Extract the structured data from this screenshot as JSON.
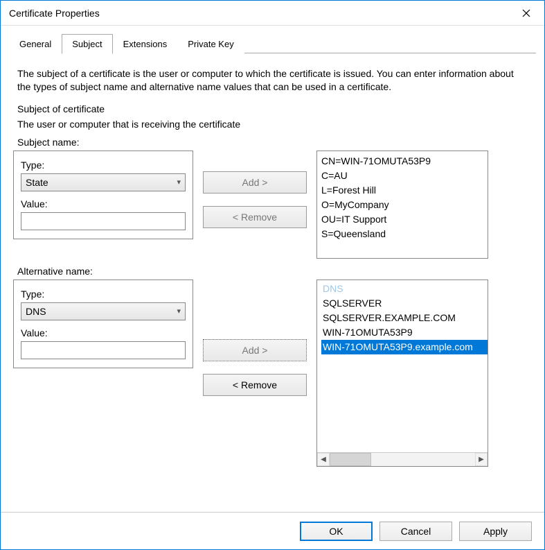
{
  "window": {
    "title": "Certificate Properties"
  },
  "tabs": [
    {
      "label": "General",
      "active": false
    },
    {
      "label": "Subject",
      "active": true
    },
    {
      "label": "Extensions",
      "active": false
    },
    {
      "label": "Private Key",
      "active": false
    }
  ],
  "subject_tab": {
    "description": "The subject of a certificate is the user or computer to which the certificate is issued. You can enter information about the types of subject name and alternative name values that can be used in a certificate.",
    "heading": "Subject of certificate",
    "subheading": "The user or computer that is receiving the certificate",
    "subject_name": {
      "section_label": "Subject name:",
      "type_label": "Type:",
      "type_value": "State",
      "value_label": "Value:",
      "value_value": "",
      "add_label": "Add >",
      "remove_label": "< Remove",
      "entries": [
        "CN=WIN-71OMUTA53P9",
        "C=AU",
        "L=Forest Hill",
        "O=MyCompany",
        "OU=IT Support",
        "S=Queensland"
      ]
    },
    "alternative_name": {
      "section_label": "Alternative name:",
      "type_label": "Type:",
      "type_value": "DNS",
      "value_label": "Value:",
      "value_value": "",
      "add_label": "Add >",
      "remove_label": "< Remove",
      "entries": [
        {
          "text": "DNS",
          "state": "faded"
        },
        {
          "text": "SQLSERVER",
          "state": "normal"
        },
        {
          "text": "SQLSERVER.EXAMPLE.COM",
          "state": "normal"
        },
        {
          "text": "WIN-71OMUTA53P9",
          "state": "normal"
        },
        {
          "text": "WIN-71OMUTA53P9.example.com",
          "state": "selected"
        }
      ]
    }
  },
  "footer": {
    "ok": "OK",
    "cancel": "Cancel",
    "apply": "Apply"
  }
}
